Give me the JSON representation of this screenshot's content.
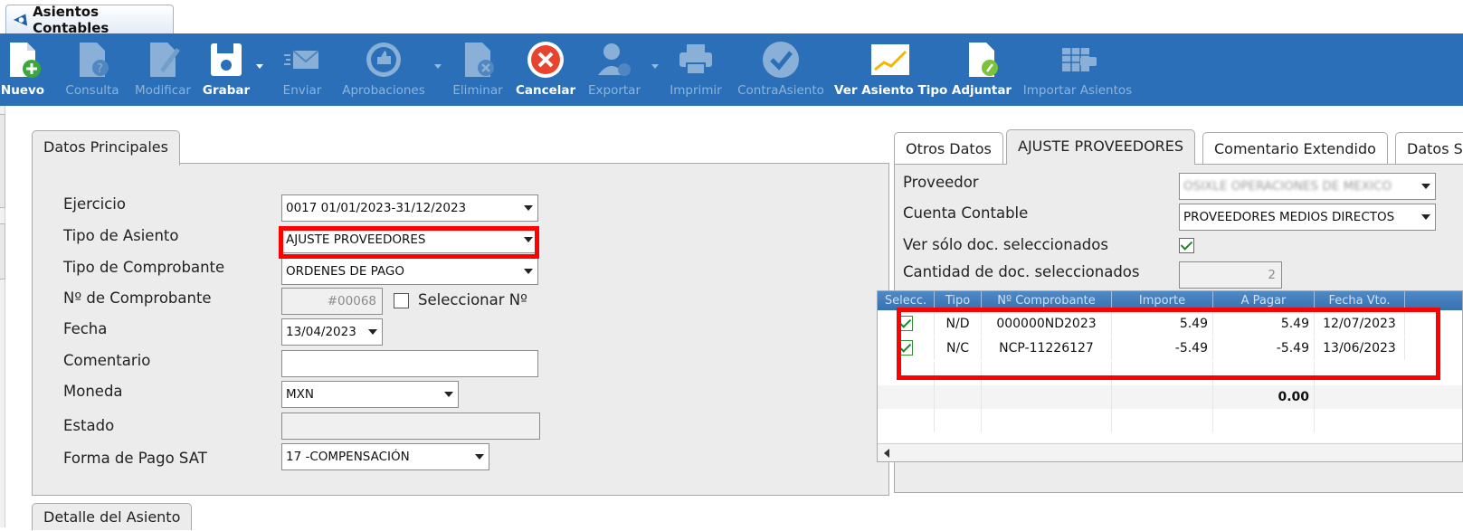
{
  "window": {
    "title": "Asientos Contables"
  },
  "toolbar": {
    "buttons": [
      {
        "label": "Nuevo",
        "icon": "new-document-icon",
        "enabled": true
      },
      {
        "label": "Consulta",
        "icon": "query-document-icon",
        "enabled": false
      },
      {
        "label": "Modificar",
        "icon": "edit-document-icon",
        "enabled": false
      },
      {
        "label": "Grabar",
        "icon": "save-disk-icon",
        "enabled": true
      },
      {
        "label": "Enviar",
        "icon": "send-mail-icon",
        "enabled": false
      },
      {
        "label": "Aprobaciones",
        "icon": "approval-icon",
        "enabled": false
      },
      {
        "label": "Eliminar",
        "icon": "delete-document-icon",
        "enabled": false
      },
      {
        "label": "Cancelar",
        "icon": "cancel-icon",
        "enabled": true
      },
      {
        "label": "Exportar",
        "icon": "export-user-icon",
        "enabled": false
      },
      {
        "label": "Imprimir",
        "icon": "printer-icon",
        "enabled": false
      },
      {
        "label": "ContraAsiento",
        "icon": "check-circle-icon",
        "enabled": false
      },
      {
        "label": "Ver Asiento Tipo",
        "icon": "chart-icon",
        "enabled": true
      },
      {
        "label": "Adjuntar",
        "icon": "attach-document-icon",
        "enabled": true
      },
      {
        "label": "Importar Asientos",
        "icon": "import-excel-icon",
        "enabled": false
      }
    ]
  },
  "main_panel": {
    "tab": "Datos Principales",
    "ejercicio": {
      "label": "Ejercicio",
      "value": "0017 01/01/2023-31/12/2023"
    },
    "tipo_asiento": {
      "label": "Tipo de Asiento",
      "value": "AJUSTE PROVEEDORES"
    },
    "tipo_comprobante": {
      "label": "Tipo de Comprobante",
      "value": "ORDENES DE PAGO"
    },
    "num_comprobante": {
      "label": "Nº de Comprobante",
      "value": "#00068",
      "select_label": "Seleccionar Nº"
    },
    "fecha": {
      "label": "Fecha",
      "value": "13/04/2023"
    },
    "comentario": {
      "label": "Comentario",
      "value": ""
    },
    "moneda": {
      "label": "Moneda",
      "value": "MXN"
    },
    "estado": {
      "label": "Estado",
      "value": ""
    },
    "forma_pago": {
      "label": "Forma de Pago SAT",
      "value": "17 -COMPENSACIÓN"
    }
  },
  "detail_tab": "Detalle del Asiento",
  "right_panel": {
    "tabs": [
      "Otros Datos",
      "AJUSTE PROVEEDORES",
      "Comentario Extendido",
      "Datos SA"
    ],
    "active_tab": 1,
    "proveedor": {
      "label": "Proveedor",
      "value": "OSIXLE OPERACIONES DE MEXICO"
    },
    "cuenta": {
      "label": "Cuenta Contable",
      "value": "PROVEEDORES MEDIOS DIRECTOS"
    },
    "ver_solo": {
      "label": "Ver sólo doc. seleccionados",
      "checked": true
    },
    "cantidad": {
      "label": "Cantidad de doc. seleccionados",
      "value": "2"
    },
    "grid": {
      "columns": [
        "Selecc.",
        "Tipo",
        "Nº Comprobante",
        "Importe",
        "A Pagar",
        "Fecha Vto."
      ],
      "rows": [
        {
          "selected": true,
          "tipo": "N/D",
          "comprobante": "000000ND2023",
          "importe": "5.49",
          "a_pagar": "5.49",
          "fecha": "12/07/2023"
        },
        {
          "selected": true,
          "tipo": "N/C",
          "comprobante": "NCP-11226127",
          "importe": "-5.49",
          "a_pagar": "-5.49",
          "fecha": "13/06/2023"
        }
      ],
      "total_a_pagar": "0.00"
    }
  },
  "colors": {
    "toolbar": "#2a6fb7",
    "highlight": "#ff0000",
    "panel": "#ececec"
  }
}
